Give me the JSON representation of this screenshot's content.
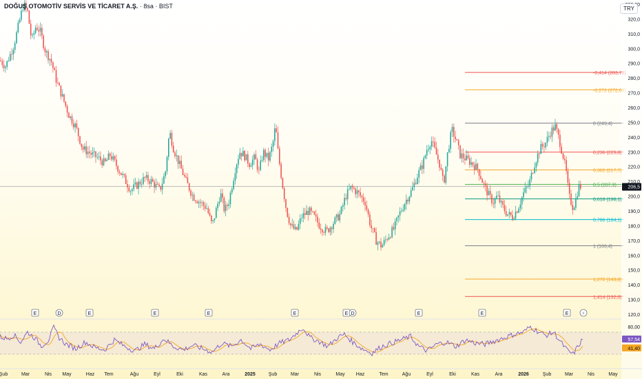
{
  "header": {
    "symbol": "DOĞUŞ OTOMOTİV SERVİS VE TİCARET A.Ş.",
    "meta": " · 8sa · BIST",
    "currency": "TRY"
  },
  "colors": {
    "up": "#26a69a",
    "down": "#ef5350",
    "rsi": "#7e57c2",
    "rsi_ma": "#f5a623"
  },
  "chart_data": {
    "type": "candlestick",
    "y_axis": {
      "min": 120,
      "max": 330,
      "ticks": [
        "120,0",
        "130,0",
        "140,0",
        "150,0",
        "160,0",
        "170,0",
        "180,0",
        "190,0",
        "200,0",
        "210,0",
        "220,0",
        "230,0",
        "240,0",
        "250,0",
        "260,0",
        "270,0",
        "280,0",
        "290,0",
        "300,0",
        "310,0",
        "320,0",
        "330,00"
      ],
      "last_price": "206,5"
    },
    "x_axis": {
      "labels": [
        "Şub",
        "Mar",
        "Nis",
        "May",
        "Haz",
        "Tem",
        "Ağu",
        "Eyl",
        "Eki",
        "Kas",
        "Ara",
        "2025",
        "Şub",
        "Mar",
        "Nis",
        "May",
        "Haz",
        "Tem",
        "Ağu",
        "Eyl",
        "Eki",
        "Kas",
        "Ara",
        "2026",
        "Şub",
        "Mar",
        "Nis",
        "May"
      ]
    },
    "price_path": [
      [
        0,
        292
      ],
      [
        8,
        288
      ],
      [
        20,
        302
      ],
      [
        28,
        318
      ],
      [
        34,
        330
      ],
      [
        40,
        325
      ],
      [
        46,
        305
      ],
      [
        52,
        315
      ],
      [
        58,
        312
      ],
      [
        66,
        298
      ],
      [
        74,
        292
      ],
      [
        82,
        278
      ],
      [
        90,
        268
      ],
      [
        100,
        255
      ],
      [
        110,
        247
      ],
      [
        120,
        232
      ],
      [
        128,
        230
      ],
      [
        134,
        228
      ],
      [
        142,
        226
      ],
      [
        152,
        222
      ],
      [
        160,
        228
      ],
      [
        170,
        220
      ],
      [
        180,
        212
      ],
      [
        190,
        204
      ],
      [
        200,
        208
      ],
      [
        210,
        212
      ],
      [
        220,
        210
      ],
      [
        232,
        204
      ],
      [
        240,
        216
      ],
      [
        246,
        244
      ],
      [
        252,
        232
      ],
      [
        260,
        222
      ],
      [
        270,
        210
      ],
      [
        280,
        200
      ],
      [
        290,
        196
      ],
      [
        300,
        192
      ],
      [
        308,
        180
      ],
      [
        320,
        202
      ],
      [
        326,
        190
      ],
      [
        332,
        196
      ],
      [
        338,
        210
      ],
      [
        342,
        220
      ],
      [
        348,
        230
      ],
      [
        354,
        228
      ],
      [
        362,
        222
      ],
      [
        370,
        226
      ],
      [
        376,
        216
      ],
      [
        382,
        230
      ],
      [
        390,
        225
      ],
      [
        396,
        235
      ],
      [
        400,
        248
      ],
      [
        404,
        228
      ],
      [
        410,
        208
      ],
      [
        416,
        190
      ],
      [
        422,
        180
      ],
      [
        430,
        176
      ],
      [
        438,
        186
      ],
      [
        448,
        190
      ],
      [
        456,
        186
      ],
      [
        464,
        180
      ],
      [
        474,
        176
      ],
      [
        484,
        182
      ],
      [
        494,
        188
      ],
      [
        502,
        200
      ],
      [
        510,
        206
      ],
      [
        520,
        202
      ],
      [
        530,
        196
      ],
      [
        538,
        180
      ],
      [
        546,
        170
      ],
      [
        554,
        166
      ],
      [
        562,
        172
      ],
      [
        572,
        178
      ],
      [
        580,
        188
      ],
      [
        588,
        196
      ],
      [
        598,
        204
      ],
      [
        606,
        214
      ],
      [
        614,
        222
      ],
      [
        620,
        232
      ],
      [
        626,
        238
      ],
      [
        632,
        230
      ],
      [
        638,
        222
      ],
      [
        644,
        208
      ],
      [
        650,
        230
      ],
      [
        656,
        245
      ],
      [
        662,
        238
      ],
      [
        668,
        228
      ],
      [
        674,
        226
      ],
      [
        680,
        224
      ],
      [
        686,
        222
      ],
      [
        694,
        218
      ],
      [
        702,
        208
      ],
      [
        710,
        200
      ],
      [
        716,
        196
      ],
      [
        722,
        200
      ],
      [
        728,
        194
      ],
      [
        736,
        188
      ],
      [
        744,
        186
      ],
      [
        752,
        192
      ],
      [
        760,
        202
      ],
      [
        768,
        208
      ],
      [
        776,
        222
      ],
      [
        784,
        232
      ],
      [
        792,
        236
      ],
      [
        800,
        244
      ],
      [
        806,
        247
      ],
      [
        812,
        238
      ],
      [
        818,
        226
      ],
      [
        822,
        216
      ],
      [
        826,
        200
      ],
      [
        832,
        192
      ],
      [
        836,
        198
      ],
      [
        840,
        206.5
      ]
    ],
    "fibonacci": [
      {
        "label": "-0,414 (283,75)",
        "color": "#ef5350"
      },
      {
        "label": "-0,272 (272,00)",
        "color": "#f5a623"
      },
      {
        "label": "0 (249,4)",
        "color": "#787b86"
      },
      {
        "label": "0,236 (229,8)",
        "color": "#ef5350"
      },
      {
        "label": "0,382 (217,7)",
        "color": "#f5a623"
      },
      {
        "label": "0,5 (207,9)",
        "color": "#4caf50"
      },
      {
        "label": "0,618 (198,1)",
        "color": "#089981"
      },
      {
        "label": "0,786 (184,1)",
        "color": "#00bcd4"
      },
      {
        "label": "1 (166,4)",
        "color": "#787b86"
      },
      {
        "label": "1,272 (143,8)",
        "color": "#f5a623"
      },
      {
        "label": "1,414 (132,0)",
        "color": "#ef5350"
      }
    ],
    "zones": [
      {
        "name": "resistance",
        "color": "#f28b82"
      },
      {
        "name": "support",
        "color": "#8be07a"
      },
      {
        "name": "fib-0786-zone",
        "color": "#7fe0d8"
      },
      {
        "name": "fib-0382-zone",
        "color": "#f7c6c6"
      }
    ],
    "events": [
      "E",
      "D",
      "E",
      "E",
      "E",
      "E",
      "E",
      "D",
      "E",
      "E",
      "E"
    ],
    "rsi": {
      "levels": [
        "80,00",
        "57,54",
        "41,40"
      ],
      "path": [
        [
          0,
          62
        ],
        [
          10,
          58
        ],
        [
          20,
          65
        ],
        [
          30,
          52
        ],
        [
          40,
          70
        ],
        [
          50,
          60
        ],
        [
          60,
          45
        ],
        [
          70,
          55
        ],
        [
          78,
          78
        ],
        [
          86,
          60
        ],
        [
          96,
          48
        ],
        [
          110,
          40
        ],
        [
          124,
          52
        ],
        [
          138,
          42
        ],
        [
          152,
          38
        ],
        [
          166,
          56
        ],
        [
          180,
          45
        ],
        [
          196,
          36
        ],
        [
          210,
          48
        ],
        [
          224,
          40
        ],
        [
          238,
          58
        ],
        [
          252,
          44
        ],
        [
          266,
          38
        ],
        [
          280,
          46
        ],
        [
          294,
          40
        ],
        [
          308,
          34
        ],
        [
          322,
          50
        ],
        [
          336,
          44
        ],
        [
          350,
          56
        ],
        [
          364,
          40
        ],
        [
          378,
          48
        ],
        [
          392,
          38
        ],
        [
          406,
          50
        ],
        [
          420,
          56
        ],
        [
          432,
          70
        ],
        [
          440,
          78
        ],
        [
          450,
          60
        ],
        [
          462,
          54
        ],
        [
          476,
          44
        ],
        [
          490,
          60
        ],
        [
          500,
          66
        ],
        [
          512,
          52
        ],
        [
          526,
          40
        ],
        [
          540,
          32
        ],
        [
          554,
          44
        ],
        [
          568,
          50
        ],
        [
          582,
          56
        ],
        [
          596,
          62
        ],
        [
          608,
          44
        ],
        [
          620,
          36
        ],
        [
          634,
          48
        ],
        [
          648,
          52
        ],
        [
          662,
          44
        ],
        [
          676,
          56
        ],
        [
          690,
          50
        ],
        [
          704,
          48
        ],
        [
          718,
          54
        ],
        [
          732,
          60
        ],
        [
          746,
          66
        ],
        [
          760,
          70
        ],
        [
          770,
          80
        ],
        [
          780,
          72
        ],
        [
          792,
          64
        ],
        [
          804,
          70
        ],
        [
          814,
          52
        ],
        [
          824,
          36
        ],
        [
          832,
          30
        ],
        [
          840,
          46
        ],
        [
          846,
          57.54
        ]
      ]
    }
  }
}
